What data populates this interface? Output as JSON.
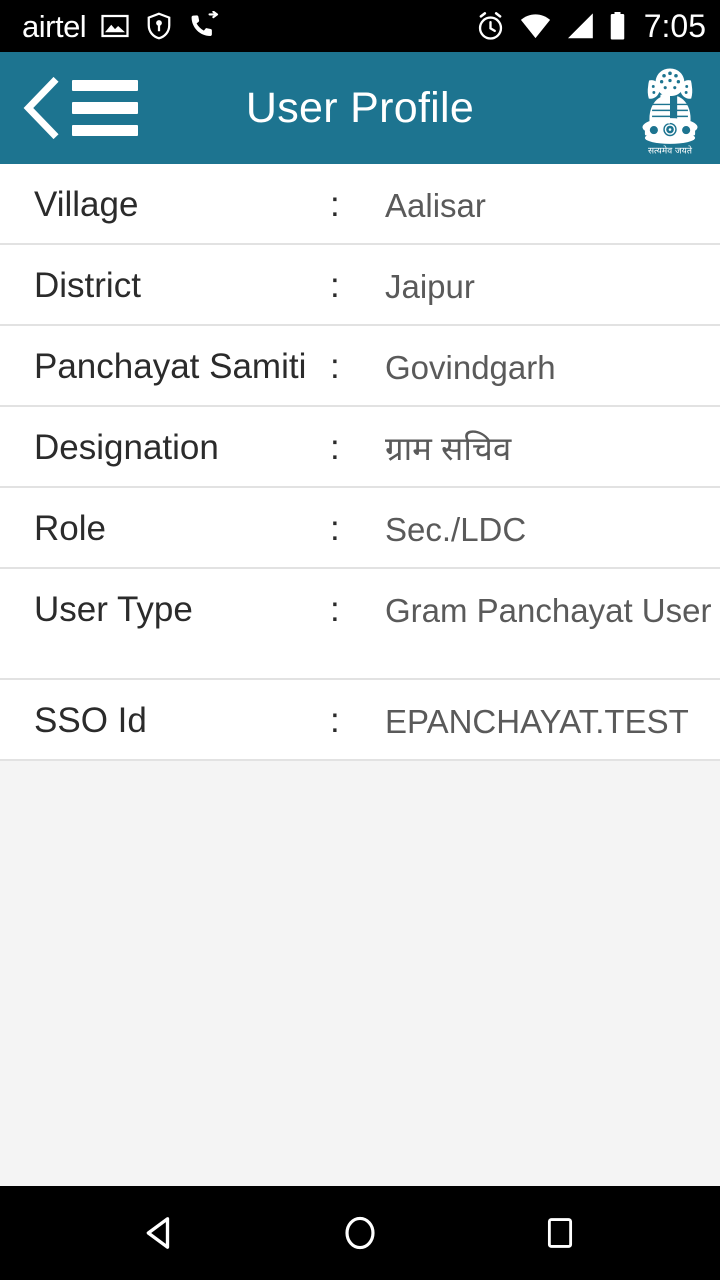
{
  "status_bar": {
    "carrier": "airtel",
    "time": "7:05",
    "icons": [
      {
        "name": "photo-icon"
      },
      {
        "name": "vpn-key-shield-icon"
      },
      {
        "name": "call-forward-icon"
      },
      {
        "name": "alarm-clock-icon"
      },
      {
        "name": "wifi-icon"
      },
      {
        "name": "cellular-signal-icon"
      },
      {
        "name": "battery-icon"
      }
    ],
    "background_color": "#000000",
    "foreground_color": "#ffffff"
  },
  "app_bar": {
    "title": "User Profile",
    "back_icon": "back-chevron-icon",
    "menu_icon": "hamburger-menu-icon",
    "emblem_icon": "india-national-emblem-icon",
    "emblem_motto": "सत्यमेव जयते",
    "background_color": "#1d7490",
    "text_color": "#ffffff"
  },
  "profile": {
    "separator": ":",
    "rows": [
      {
        "label": "Village",
        "value": "Aalisar"
      },
      {
        "label": "District",
        "value": "Jaipur"
      },
      {
        "label": "Panchayat Samiti",
        "value": "Govindgarh"
      },
      {
        "label": "Designation",
        "value": "ग्राम सचिव"
      },
      {
        "label": "Role",
        "value": "Sec./LDC"
      },
      {
        "label": "User Type",
        "value": "Gram Panchayat User"
      },
      {
        "label": "SSO Id",
        "value": "EPANCHAYAT.TEST"
      }
    ],
    "label_color": "#2b2b2b",
    "value_color": "#5a5a5a",
    "row_background": "#ffffff",
    "divider_color": "#e2e2e2",
    "page_background": "#f4f4f4"
  },
  "nav_bar": {
    "back_label": "Back",
    "home_label": "Home",
    "recents_label": "Recent apps",
    "background_color": "#000000"
  }
}
